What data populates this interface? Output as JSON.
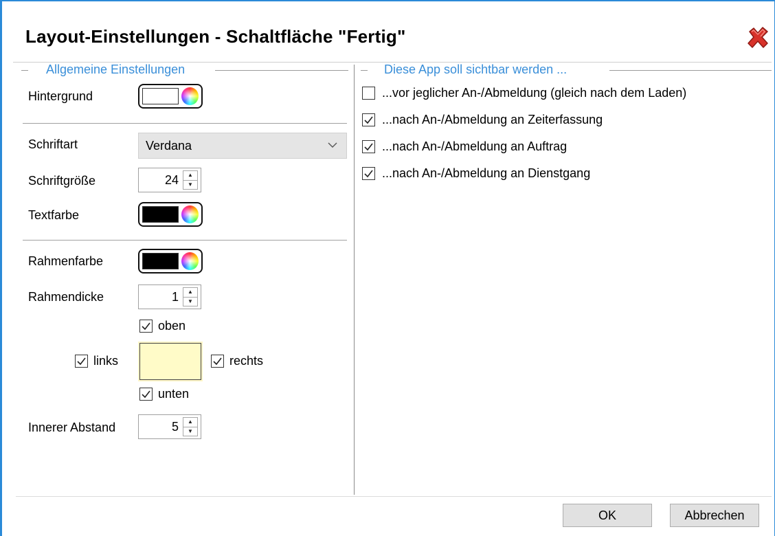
{
  "dialog": {
    "title": "Layout-Einstellungen - Schaltfläche \"Fertig\""
  },
  "general": {
    "caption": "Allgemeine Einstellungen",
    "background_label": "Hintergrund",
    "background_color": "#ffffff",
    "font_label": "Schriftart",
    "font_value": "Verdana",
    "fontsize_label": "Schriftgröße",
    "fontsize_value": "24",
    "textcolor_label": "Textfarbe",
    "text_color": "#000000",
    "bordercolor_label": "Rahmenfarbe",
    "border_color": "#000000",
    "borderwidth_label": "Rahmendicke",
    "borderwidth_value": "1",
    "border_top_label": "oben",
    "border_left_label": "links",
    "border_right_label": "rechts",
    "border_bottom_label": "unten",
    "border_top_checked": true,
    "border_left_checked": true,
    "border_right_checked": true,
    "border_bottom_checked": true,
    "padding_label": "Innerer Abstand",
    "padding_value": "5",
    "preview_color": "#fffbc8"
  },
  "visibility": {
    "caption": "Diese App soll sichtbar werden ...",
    "options": [
      {
        "label": "...vor jeglicher An-/Abmeldung (gleich nach dem Laden)",
        "checked": false
      },
      {
        "label": "...nach An-/Abmeldung an Zeiterfassung",
        "checked": true
      },
      {
        "label": "...nach An-/Abmeldung an Auftrag",
        "checked": true
      },
      {
        "label": "...nach An-/Abmeldung an Dienstgang",
        "checked": true
      }
    ]
  },
  "footer": {
    "ok_label": "OK",
    "cancel_label": "Abbrechen"
  },
  "colors": {
    "accent": "#2b8ad8",
    "caption": "#3a8fd9",
    "close_icon": "#d8322a"
  }
}
